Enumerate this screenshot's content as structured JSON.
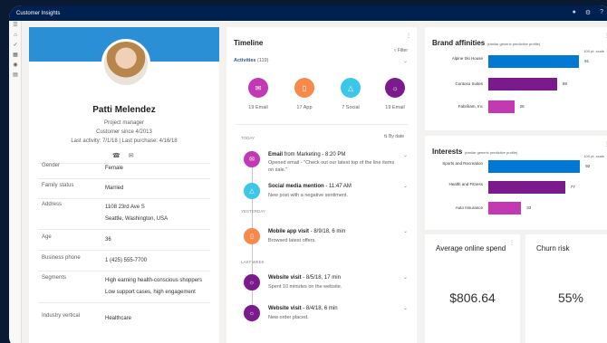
{
  "app": {
    "title": "Customer Insights"
  },
  "topbar_icons": [
    "bell-icon",
    "gear-icon",
    "help-icon"
  ],
  "profile": {
    "name": "Patti Melendez",
    "role": "Project manager",
    "customer_since": "Customer since 4/2013",
    "last_activity": "Last activity: 7/1/18  |  Last purchase: 4/16/18",
    "fields": [
      {
        "key": "Gender",
        "value": "Female"
      },
      {
        "key": "Family status",
        "value": "Married"
      },
      {
        "key": "Address",
        "value": "1108 23rd Ave S",
        "value2": "Seattle, Washington, USA"
      },
      {
        "key": "Age",
        "value": "36"
      },
      {
        "key": "Business phone",
        "value": "1 (425) 555-7700"
      },
      {
        "key": "Segments",
        "value": "High earning health-conscious shoppers",
        "value2": "Low support cases, high engagement"
      },
      {
        "key": "Industry vertical",
        "value": "Healthcare"
      }
    ]
  },
  "timeline": {
    "title": "Timeline",
    "filter": "Filter",
    "activities_label": "Activities",
    "activities_count": "(119)",
    "sort": "By date",
    "activities": [
      {
        "label": "19 Email",
        "color": "#c239b3",
        "icon": "mail-icon"
      },
      {
        "label": "17 App",
        "color": "#f7894a",
        "icon": "phone-icon"
      },
      {
        "label": "7 Social",
        "color": "#3bc7e8",
        "icon": "social-icon"
      },
      {
        "label": "19 Email",
        "color": "#7a1a8c",
        "icon": "globe-icon"
      }
    ],
    "sections": [
      "TODAY",
      "YESTERDAY",
      "LAST WEEK"
    ],
    "events": [
      {
        "title_bold": "Email",
        "title_rest": " from Marketing - 8:20 PM",
        "desc": "Opened  email - \"Check out our latest top of the line items on sale.\"",
        "color": "#c239b3",
        "icon": "mail-icon"
      },
      {
        "title_bold": "Social media mention",
        "title_rest": " - 11:47 AM",
        "desc": "New post with a negative sentiment.",
        "color": "#3bc7e8",
        "icon": "social-icon"
      },
      {
        "title_bold": "Mobile app visit",
        "title_rest": " - 8/9/18, 6 min",
        "desc": "Browsed latest offers.",
        "color": "#f7894a",
        "icon": "phone-icon"
      },
      {
        "title_bold": "Website visit",
        "title_rest": " - 8/5/18, 17 min",
        "desc": "Spent 10 minutes on the website.",
        "color": "#7a1a8c",
        "icon": "globe-icon"
      },
      {
        "title_bold": "Website visit",
        "title_rest": " - 8/4/18, 6 min",
        "desc": "New order placed.",
        "color": "#7a1a8c",
        "icon": "globe-icon"
      }
    ]
  },
  "brand": {
    "title": "Brand affinities",
    "subtitle": "(similar generic predictive profile)",
    "scale": "100 pt. scale",
    "items": [
      {
        "label": "Alpine Ski House",
        "value": 91,
        "color": "#0078d4"
      },
      {
        "label": "Contoso Suites",
        "value": 69,
        "color": "#7a1a8c"
      },
      {
        "label": "Fabrikam, Inc",
        "value": 26,
        "color": "#c239b3"
      }
    ]
  },
  "interests": {
    "title": "Interests",
    "subtitle": "(similar generic predictive profile)",
    "scale": "100 pt. scale",
    "items": [
      {
        "label": "Sports and Recreation",
        "value": 92,
        "color": "#0078d4"
      },
      {
        "label": "Health and Fitness",
        "value": 77,
        "color": "#7a1a8c"
      },
      {
        "label": "Auto Insurance",
        "value": 33,
        "color": "#c239b3"
      }
    ]
  },
  "kpis": {
    "avg_spend_title": "Average online spend",
    "avg_spend_value": "$806.64",
    "churn_title": "Churn risk",
    "churn_value": "55%"
  }
}
